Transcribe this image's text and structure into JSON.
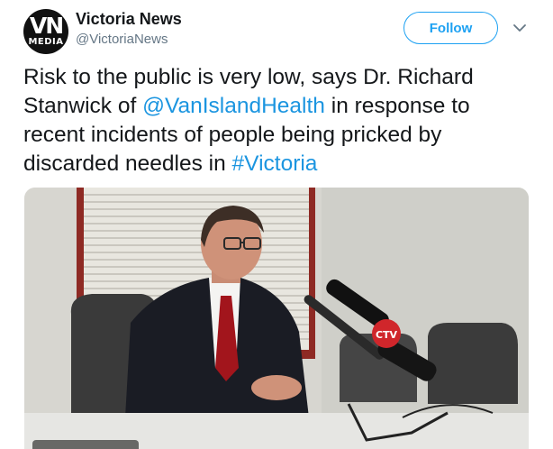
{
  "account": {
    "name": "Victoria News",
    "handle": "@VictoriaNews",
    "avatar_text_top": "VN",
    "avatar_text_bottom": "MEDIA"
  },
  "actions": {
    "follow_label": "Follow",
    "more_icon": "chevron-down-icon"
  },
  "tweet": {
    "text_before_mention": "Risk to the public is very low, says Dr. Richard Stanwick of ",
    "mention": "@VanIslandHealth",
    "text_after_mention": " in response to recent incidents of people being pricked by discarded needles in ",
    "hashtag": "#Victoria"
  },
  "media": {
    "type": "video",
    "microphone_logo": "CTV"
  },
  "colors": {
    "link": "#1b95e0",
    "follow_border": "#1da1f2",
    "text": "#14171a",
    "secondary": "#657786"
  }
}
